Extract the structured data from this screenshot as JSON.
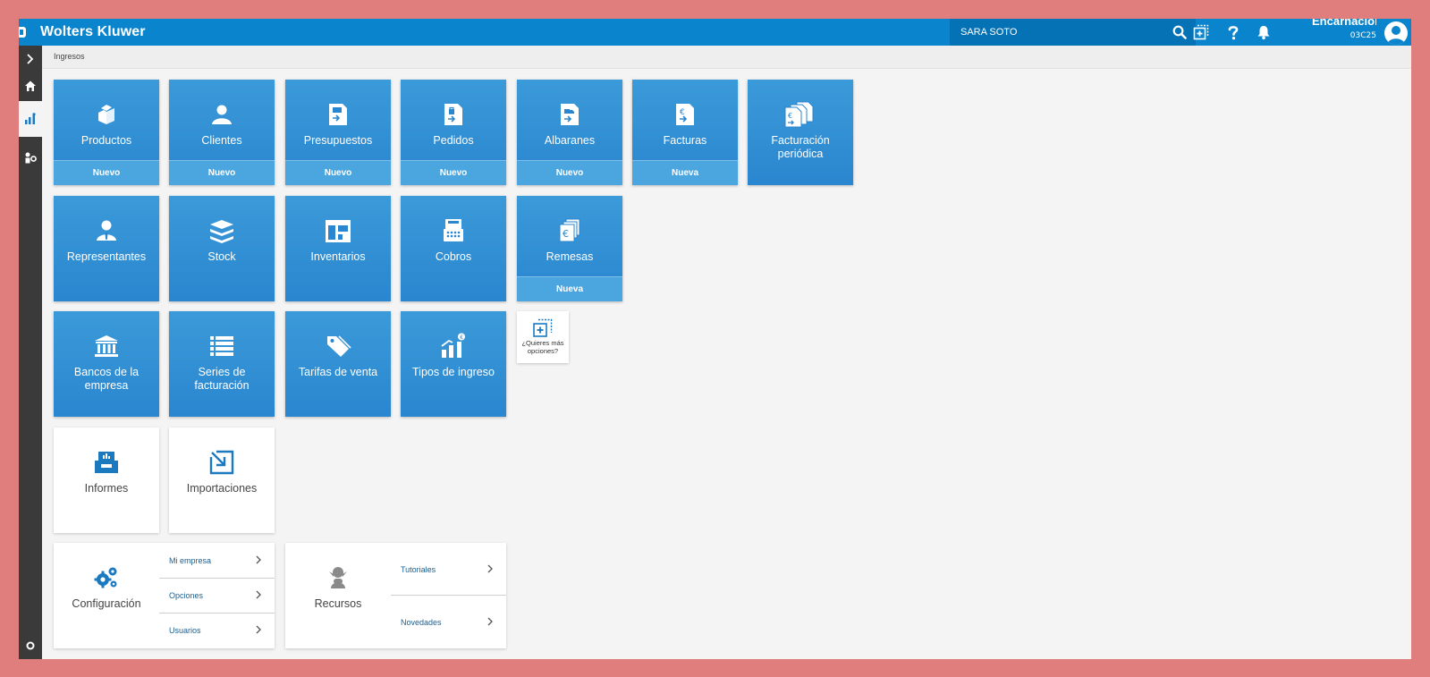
{
  "brand": {
    "name": "Wolters Kluwer"
  },
  "search": {
    "value": "",
    "placeholder": "SARA SOTO"
  },
  "user": {
    "name": "Encarnación",
    "code": "03C25"
  },
  "breadcrumb": "Ingresos",
  "colors": {
    "topbar": "#0a84cc",
    "tile": "#2a86cf",
    "rail": "#3a3a3a",
    "frame": "#e07d7d"
  },
  "tiles_row1": [
    {
      "label": "Productos",
      "action": "Nuevo",
      "icon": "box-icon"
    },
    {
      "label": "Clientes",
      "action": "Nuevo",
      "icon": "user-icon"
    },
    {
      "label": "Presupuestos",
      "action": "Nuevo",
      "icon": "budget-document-icon"
    },
    {
      "label": "Pedidos",
      "action": "Nuevo",
      "icon": "order-document-icon"
    },
    {
      "label": "Albaranes",
      "action": "Nuevo",
      "icon": "delivery-document-icon"
    },
    {
      "label": "Facturas",
      "action": "Nueva",
      "icon": "invoice-document-icon"
    },
    {
      "label": "Facturación periódica",
      "icon": "recurring-invoice-icon"
    }
  ],
  "tiles_row2": [
    {
      "label": "Representantes",
      "icon": "representative-icon"
    },
    {
      "label": "Stock",
      "icon": "stack-icon"
    },
    {
      "label": "Inventarios",
      "icon": "inventory-icon"
    },
    {
      "label": "Cobros",
      "icon": "cash-register-icon"
    },
    {
      "label": "Remesas",
      "action": "Nueva",
      "icon": "remittance-icon"
    }
  ],
  "tiles_row3": [
    {
      "label": "Bancos de la empresa",
      "icon": "bank-icon"
    },
    {
      "label": "Series de facturación",
      "icon": "list-icon"
    },
    {
      "label": "Tarifas de venta",
      "icon": "price-tag-icon"
    },
    {
      "label": "Tipos de ingreso",
      "icon": "income-chart-icon"
    }
  ],
  "more_options": {
    "label": "¿Quieres más opciones?"
  },
  "tiles_row4": [
    {
      "label": "Informes",
      "icon": "report-tray-icon"
    },
    {
      "label": "Importaciones",
      "icon": "import-icon"
    }
  ],
  "config_panel": {
    "label": "Configuración",
    "links": [
      "Mi empresa",
      "Opciones",
      "Usuarios"
    ]
  },
  "resources_panel": {
    "label": "Recursos",
    "links": [
      "Tutoriales",
      "Novedades"
    ]
  }
}
